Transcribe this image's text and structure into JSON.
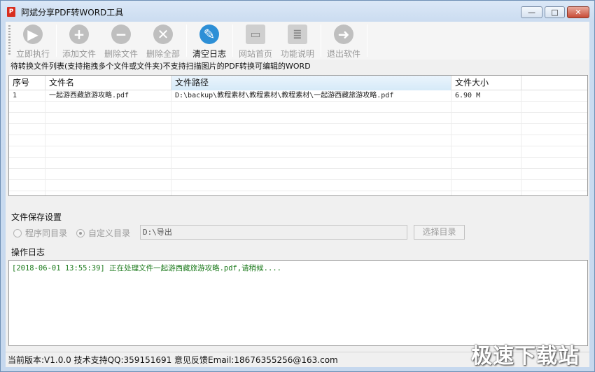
{
  "window": {
    "title": "阿斌分享PDF转WORD工具",
    "icon_glyph": "P",
    "controls": {
      "minimize": "—",
      "maximize": "□",
      "close": "✕"
    }
  },
  "toolbar": {
    "items": [
      {
        "label": "立即执行",
        "icon": "play-icon",
        "glyph": "▶"
      },
      {
        "label": "添加文件",
        "icon": "plus-icon",
        "glyph": "+"
      },
      {
        "label": "删除文件",
        "icon": "minus-icon",
        "glyph": "−"
      },
      {
        "label": "删除全部",
        "icon": "close-icon",
        "glyph": "✕"
      },
      {
        "label": "清空日志",
        "icon": "broom-icon",
        "glyph": "✎"
      },
      {
        "label": "网站首页",
        "icon": "monitor-icon",
        "glyph": "▭"
      },
      {
        "label": "功能说明",
        "icon": "document-icon",
        "glyph": "≣"
      },
      {
        "label": "退出软件",
        "icon": "exit-icon",
        "glyph": "➜"
      }
    ]
  },
  "file_list": {
    "caption": "待转换文件列表(支持拖拽多个文件或文件夹)不支持扫描图片的PDF转换可编辑的WORD",
    "columns": [
      "序号",
      "文件名",
      "文件路径",
      "文件大小"
    ],
    "rows": [
      {
        "index": "1",
        "name": "一起游西藏旅游攻略.pdf",
        "path": "D:\\backup\\教程素材\\教程素材\\教程素材\\一起游西藏旅游攻略.pdf",
        "size": "6.90 M"
      }
    ]
  },
  "save_settings": {
    "label": "文件保存设置",
    "option_same_dir": "程序同目录",
    "option_custom_dir": "自定义目录",
    "path_value": "D:\\导出",
    "choose_button": "选择目录"
  },
  "log": {
    "label": "操作日志",
    "lines": [
      "[2018-06-01 13:55:39] 正在处理文件一起游西藏旅游攻略.pdf,请稍候...."
    ]
  },
  "status": {
    "text": "当前版本:V1.0.0  技术支持QQ:359151691  意见反馈Email:18676355256@163.com"
  },
  "watermark": "极速下载站",
  "colors": {
    "accent": "#2d8fd6",
    "log_text": "#1c7a1c",
    "close_button": "#c74a36"
  }
}
